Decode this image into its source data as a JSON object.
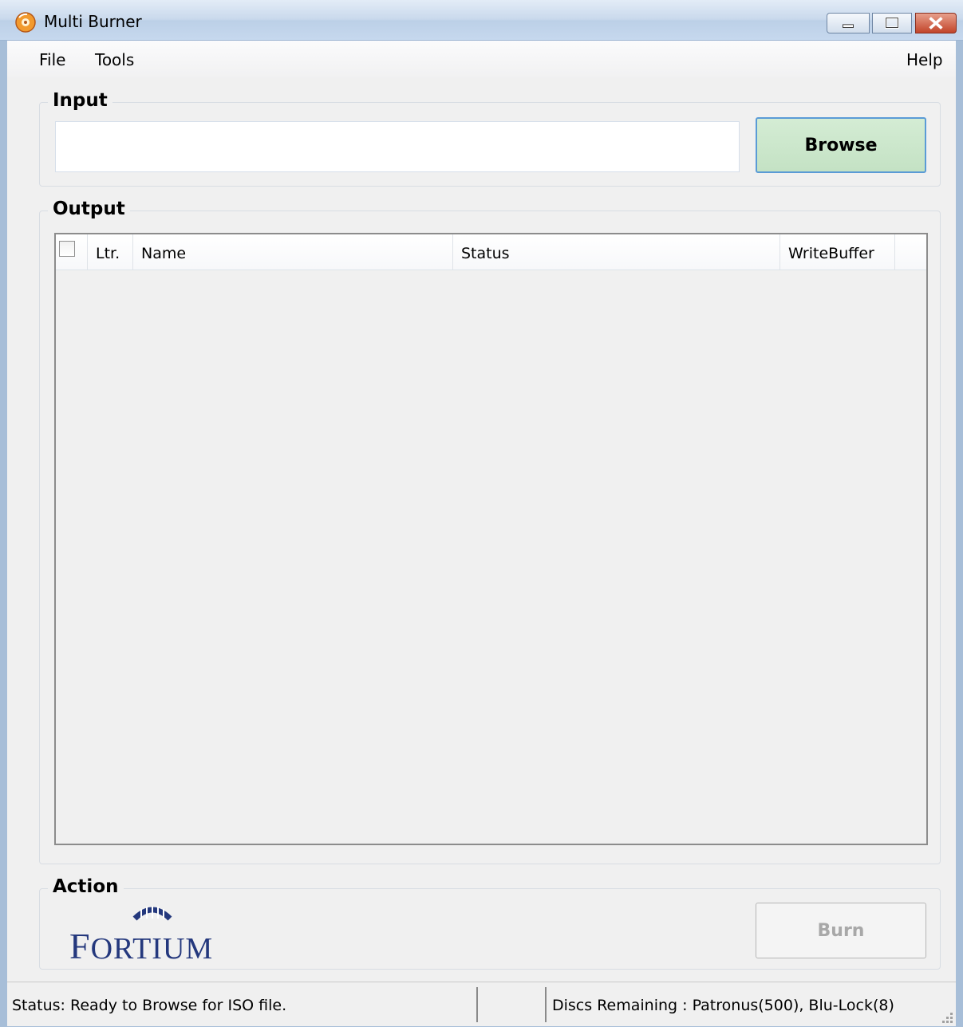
{
  "window": {
    "title": "Multi Burner"
  },
  "menu": {
    "file": "File",
    "tools": "Tools",
    "help": "Help"
  },
  "input_group": {
    "title": "Input",
    "path_value": "",
    "browse_label": "Browse"
  },
  "output_group": {
    "title": "Output",
    "columns": [
      "Ltr.",
      "Name",
      "Status",
      "WriteBuffer"
    ],
    "rows": []
  },
  "action_group": {
    "title": "Action",
    "burn_label": "Burn",
    "logo_text": "FORTIUM"
  },
  "status_bar": {
    "status": "Status: Ready to Browse for ISO file.",
    "middle": "",
    "discs": "Discs Remaining : Patronus(500), Blu-Lock(8)"
  },
  "colors": {
    "browse_bg": "#c8e6c8",
    "browse_border": "#5a9bd6",
    "logo": "#24387d",
    "title_bar": "#c9d9ec"
  }
}
